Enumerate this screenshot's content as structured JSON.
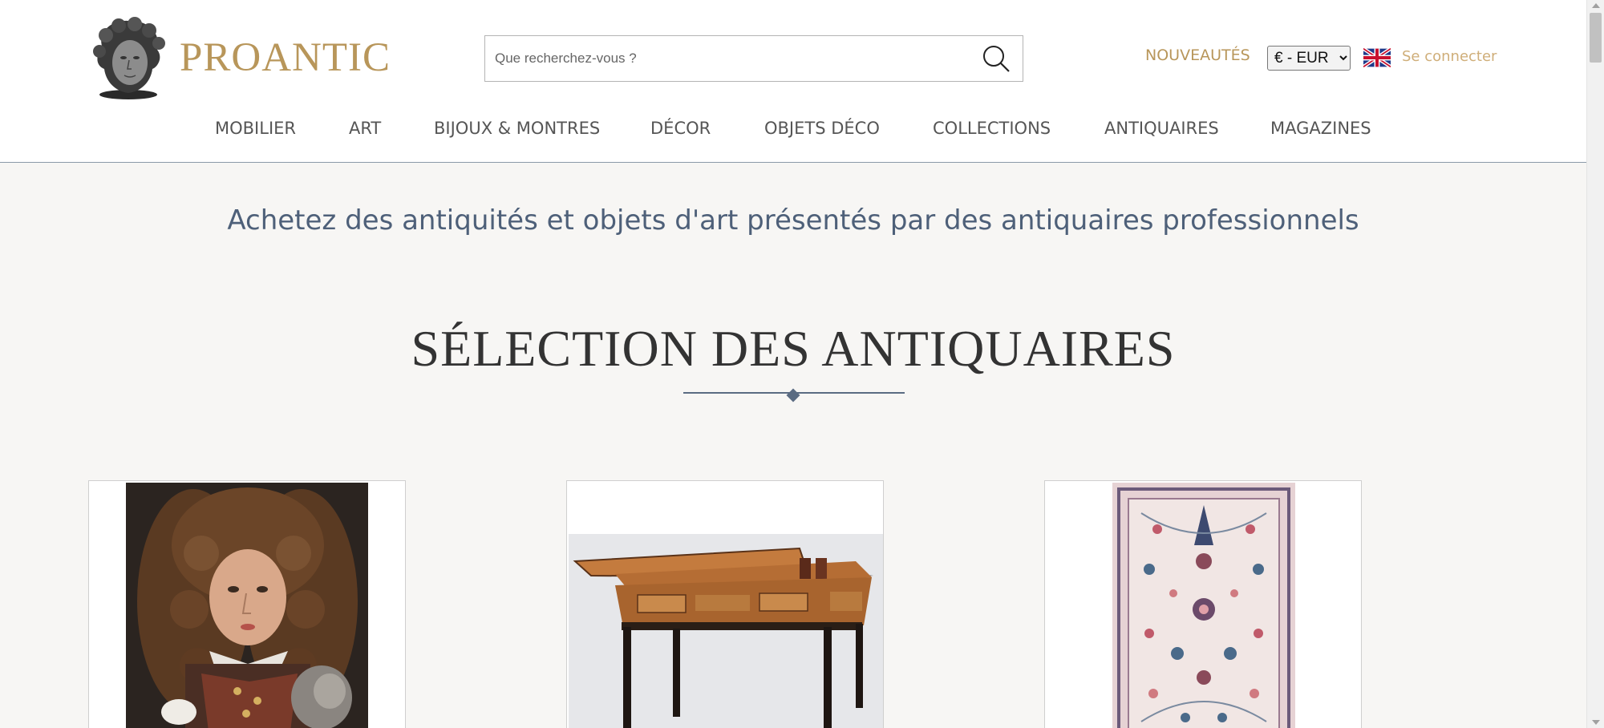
{
  "header": {
    "brand": "PROANTIC",
    "search_placeholder": "Que recherchez-vous ?",
    "search_value": "",
    "new_label": "NOUVEAUTÉS",
    "currency_selected": "€ - EUR",
    "language_flag_icon": "uk-flag-icon",
    "login_label": "Se connecter"
  },
  "nav": {
    "items": [
      {
        "label": "MOBILIER"
      },
      {
        "label": "ART"
      },
      {
        "label": "BIJOUX & MONTRES"
      },
      {
        "label": "DÉCOR"
      },
      {
        "label": "OBJETS DÉCO"
      },
      {
        "label": "COLLECTIONS"
      },
      {
        "label": "ANTIQUAIRES"
      },
      {
        "label": "MAGAZINES"
      }
    ]
  },
  "main": {
    "tagline": "Achetez des antiquités et objets d'art présentés par des antiquaires professionnels",
    "section_title": "SÉLECTION DES ANTIQUAIRES",
    "products": [
      {
        "image": "portrait-painting-image"
      },
      {
        "image": "marquetry-table-image"
      },
      {
        "image": "persian-rug-image"
      }
    ]
  },
  "colors": {
    "brand_gold": "#b8965a",
    "login_gold": "#cfae79",
    "tagline_blue": "#4e6079",
    "background": "#f7f6f4"
  }
}
